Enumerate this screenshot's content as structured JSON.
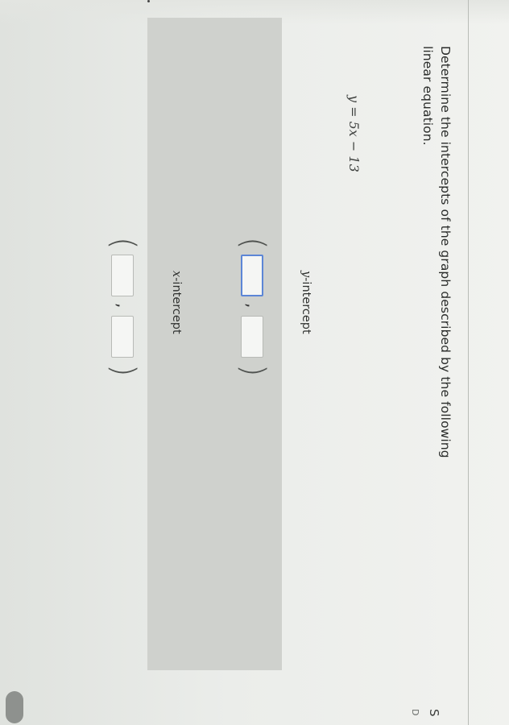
{
  "question": {
    "prompt": "Determine the intercepts of the graph described by the following linear equation.",
    "equation": "y = 5x − 13"
  },
  "answers": {
    "y_intercept": {
      "variable": "y",
      "label_suffix": "-intercept",
      "open_paren": "(",
      "close_paren": ")",
      "separator": ",",
      "x_value": "",
      "y_value": ""
    },
    "x_intercept": {
      "variable": "x",
      "label_suffix": "-intercept",
      "open_paren": "(",
      "close_paren": ")",
      "separator": ",",
      "x_value": "",
      "y_value": ""
    }
  },
  "sidebar": {
    "letter_top": "S",
    "letter_bottom": "D"
  },
  "colors": {
    "active_input_border": "#5c86d6",
    "panel_background": "#cfd1cd"
  }
}
